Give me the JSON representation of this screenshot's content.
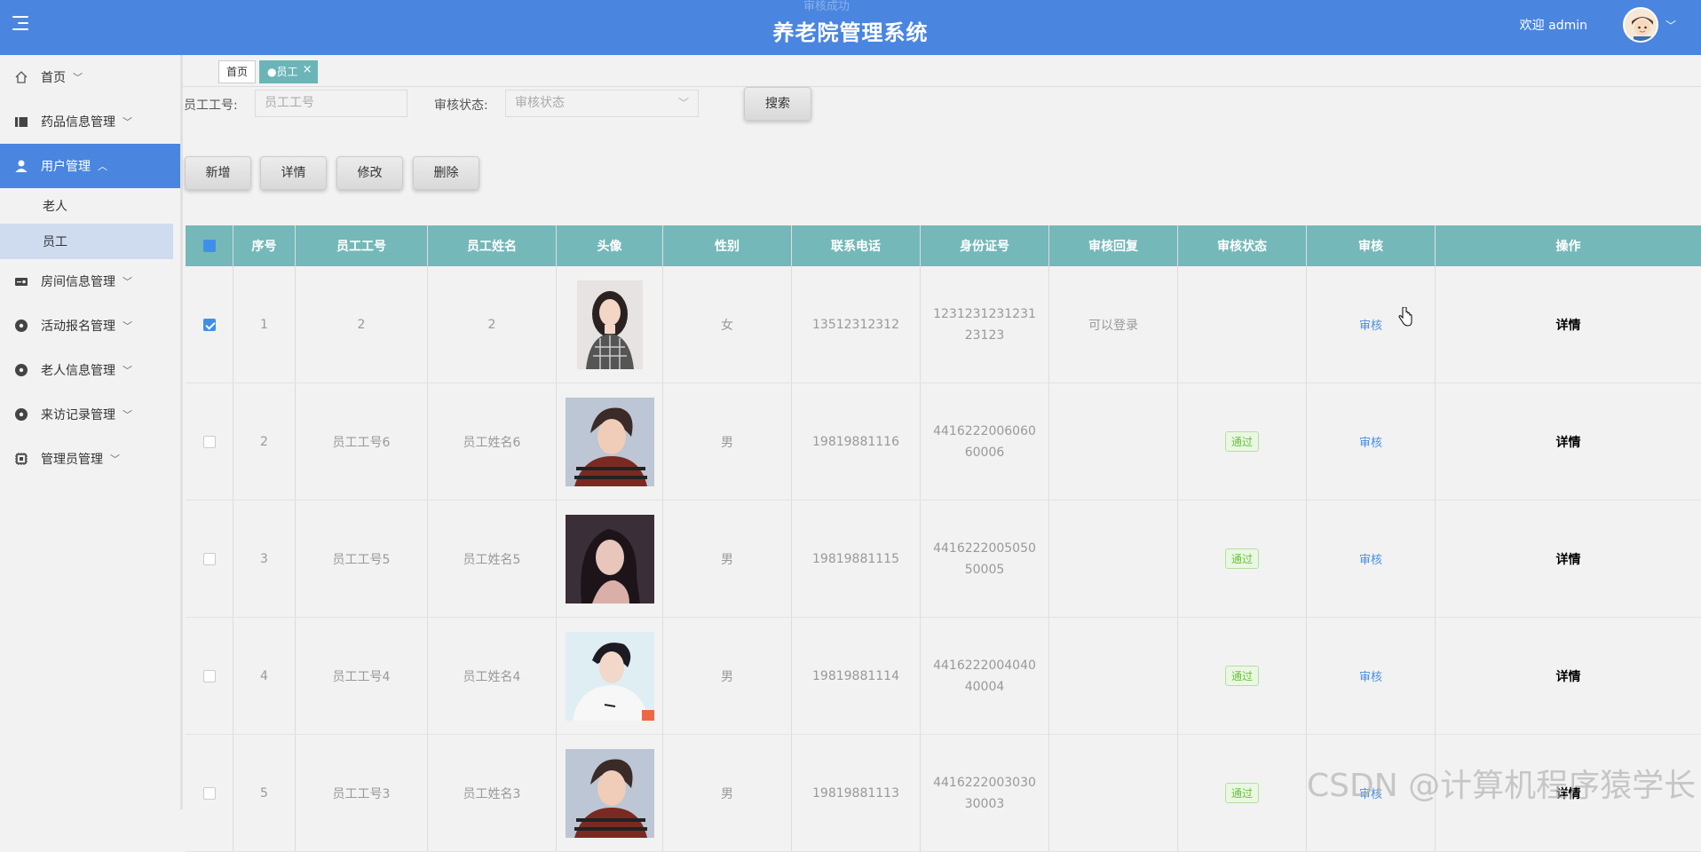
{
  "header": {
    "title": "养老院管理系统",
    "toast": "审核成功",
    "welcome": "欢迎 admin"
  },
  "sidebar": {
    "items": [
      {
        "label": "首页",
        "icon": "home-icon"
      },
      {
        "label": "药品信息管理",
        "icon": "book-icon"
      },
      {
        "label": "用户管理",
        "icon": "user-icon"
      },
      {
        "label": "房间信息管理",
        "icon": "room-icon"
      },
      {
        "label": "活动报名管理",
        "icon": "circle-icon"
      },
      {
        "label": "老人信息管理",
        "icon": "circle-icon"
      },
      {
        "label": "来访记录管理",
        "icon": "circle-icon"
      },
      {
        "label": "管理员管理",
        "icon": "chip-icon"
      }
    ],
    "subitems": [
      "老人",
      "员工"
    ]
  },
  "tabs": {
    "home": "首页",
    "active": "●员工"
  },
  "search": {
    "employee_no_label": "员工工号:",
    "employee_no_placeholder": "员工工号",
    "status_label": "审核状态:",
    "status_placeholder": "审核状态",
    "search_button": "搜索"
  },
  "actions": {
    "add": "新增",
    "detail": "详情",
    "edit": "修改",
    "delete": "删除"
  },
  "table": {
    "headers": [
      "序号",
      "员工工号",
      "员工姓名",
      "头像",
      "性别",
      "联系电话",
      "身份证号",
      "审核回复",
      "审核状态",
      "审核",
      "操作"
    ],
    "rows": [
      {
        "no": "1",
        "emp_no": "2",
        "name": "2",
        "gender": "女",
        "phone": "13512312312",
        "id": "123123123123123123",
        "reply": "可以登录",
        "status": "",
        "audit": "审核",
        "op": "详情"
      },
      {
        "no": "2",
        "emp_no": "员工工号6",
        "name": "员工姓名6",
        "gender": "男",
        "phone": "19819881116",
        "id": "441622200606060006",
        "reply": "",
        "status": "通过",
        "audit": "审核",
        "op": "详情"
      },
      {
        "no": "3",
        "emp_no": "员工工号5",
        "name": "员工姓名5",
        "gender": "男",
        "phone": "19819881115",
        "id": "441622200505050005",
        "reply": "",
        "status": "通过",
        "audit": "审核",
        "op": "详情"
      },
      {
        "no": "4",
        "emp_no": "员工工号4",
        "name": "员工姓名4",
        "gender": "男",
        "phone": "19819881114",
        "id": "441622200404040004",
        "reply": "",
        "status": "通过",
        "audit": "审核",
        "op": "详情"
      },
      {
        "no": "5",
        "emp_no": "员工工号3",
        "name": "员工姓名3",
        "gender": "男",
        "phone": "19819881113",
        "id": "441622200303030003",
        "reply": "",
        "status": "通过",
        "audit": "审核",
        "op": "详情"
      }
    ]
  },
  "watermark": "CSDN @计算机程序猿学长"
}
